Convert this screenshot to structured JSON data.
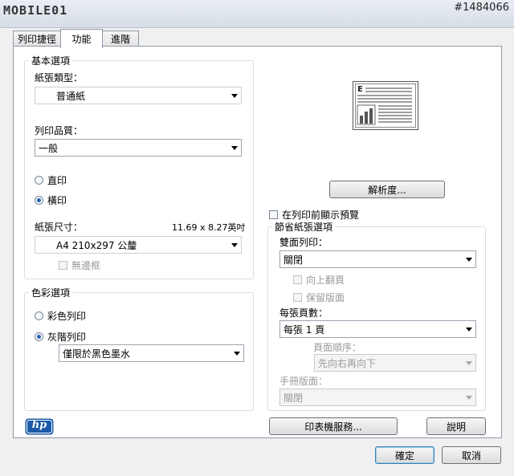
{
  "header": {
    "logo_text": "MOBILE01",
    "watermark": "#1484066"
  },
  "tabs": [
    {
      "label": "列印捷徑"
    },
    {
      "label": "功能"
    },
    {
      "label": "進階"
    }
  ],
  "basic": {
    "legend": "基本選項",
    "paper_type_label": "紙張類型：",
    "paper_type_value": "普通紙",
    "quality_label": "列印品質：",
    "quality_value": "一般",
    "portrait_label": "直印",
    "landscape_label": "橫印",
    "orientation_selected": "landscape",
    "paper_size_label": "紙張尺寸：",
    "paper_size_dims": "11.69 x 8.27英吋",
    "paper_size_value": "A4 210x297 公釐",
    "borderless_label": "無邊框"
  },
  "color": {
    "legend": "色彩選項",
    "color_label": "彩色列印",
    "grayscale_label": "灰階列印",
    "selected": "grayscale",
    "grayscale_mode_value": "僅限於黑色墨水"
  },
  "right": {
    "resolution_button": "解析度...",
    "preview_label": "在列印前顯示預覽",
    "paper_saving_legend": "節省紙張選項",
    "duplex_label": "雙面列印：",
    "duplex_value": "關閉",
    "flip_up_label": "向上翻頁",
    "preserve_layout_label": "保留版面",
    "pages_per_sheet_label": "每張頁數：",
    "pages_per_sheet_value": "每張 1 頁",
    "page_order_label": "頁面順序：",
    "page_order_value": "先向右再向下",
    "booklet_label": "手冊版面：",
    "booklet_value": "關閉"
  },
  "bottom": {
    "brand": "hp",
    "printer_services_button": "印表機服務...",
    "help_button": "說明",
    "ok_button": "確定",
    "cancel_button": "取消"
  },
  "colors": {
    "accent": "#2a61b3",
    "hp_blue": "#1a5aa8",
    "group_border": "#d5dfe5"
  }
}
